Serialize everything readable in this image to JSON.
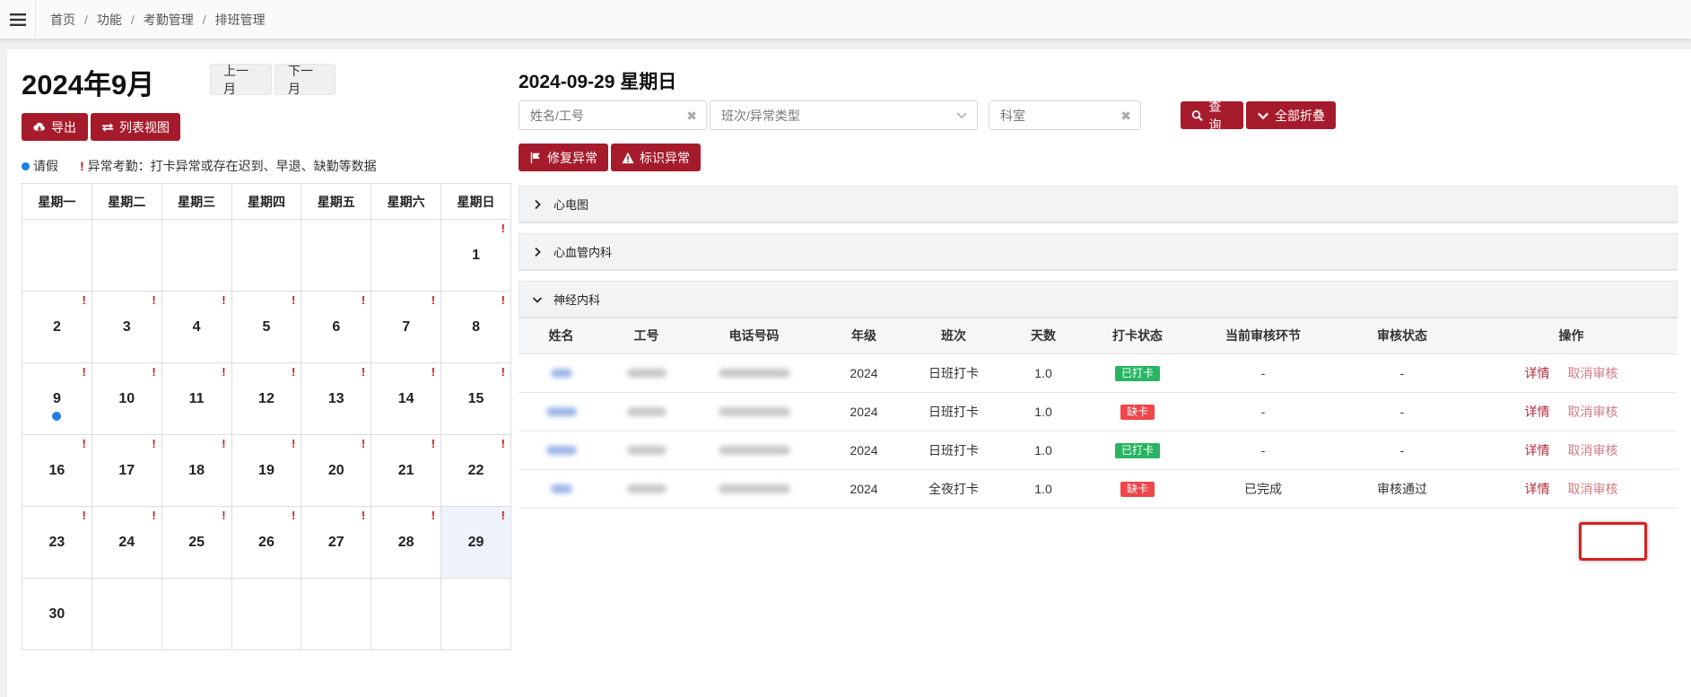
{
  "breadcrumb": [
    "首页",
    "功能",
    "考勤管理",
    "排班管理"
  ],
  "calendar": {
    "month_title": "2024年9月",
    "prev_label": "上一月",
    "next_label": "下一月",
    "export_label": "导出",
    "list_view_label": "列表视图",
    "legend_leave": "请假",
    "legend_abnormal": "异常考勤：打卡异常或存在迟到、早退、缺勤等数据",
    "weekdays": [
      "星期一",
      "星期二",
      "星期三",
      "星期四",
      "星期五",
      "星期六",
      "星期日"
    ],
    "weeks": [
      [
        null,
        null,
        null,
        null,
        null,
        null,
        {
          "d": "1",
          "abnormal": true
        }
      ],
      [
        {
          "d": "2",
          "abnormal": true
        },
        {
          "d": "3",
          "abnormal": true
        },
        {
          "d": "4",
          "abnormal": true
        },
        {
          "d": "5",
          "abnormal": true
        },
        {
          "d": "6",
          "abnormal": true
        },
        {
          "d": "7",
          "abnormal": true
        },
        {
          "d": "8",
          "abnormal": true
        }
      ],
      [
        {
          "d": "9",
          "abnormal": true,
          "leave": true
        },
        {
          "d": "10",
          "abnormal": true
        },
        {
          "d": "11",
          "abnormal": true
        },
        {
          "d": "12",
          "abnormal": true
        },
        {
          "d": "13",
          "abnormal": true
        },
        {
          "d": "14",
          "abnormal": true
        },
        {
          "d": "15",
          "abnormal": true
        }
      ],
      [
        {
          "d": "16",
          "abnormal": true
        },
        {
          "d": "17",
          "abnormal": true
        },
        {
          "d": "18",
          "abnormal": true
        },
        {
          "d": "19",
          "abnormal": true
        },
        {
          "d": "20",
          "abnormal": true
        },
        {
          "d": "21",
          "abnormal": true
        },
        {
          "d": "22",
          "abnormal": true
        }
      ],
      [
        {
          "d": "23",
          "abnormal": true
        },
        {
          "d": "24",
          "abnormal": true
        },
        {
          "d": "25",
          "abnormal": true
        },
        {
          "d": "26",
          "abnormal": true
        },
        {
          "d": "27",
          "abnormal": true
        },
        {
          "d": "28",
          "abnormal": true
        },
        {
          "d": "29",
          "abnormal": true,
          "today": true
        }
      ],
      [
        {
          "d": "30"
        },
        null,
        null,
        null,
        null,
        null,
        null
      ]
    ]
  },
  "detail": {
    "date_title": "2024-09-29 星期日",
    "name_placeholder": "姓名/工号",
    "shift_placeholder": "班次/异常类型",
    "dept_placeholder": "科室",
    "query_label": "查询",
    "collapse_label": "全部折叠",
    "fix_label": "修复异常",
    "mark_label": "标识异常",
    "sections": [
      "心电图",
      "心血管内科",
      "神经内科"
    ],
    "columns": [
      "姓名",
      "工号",
      "电话号码",
      "年级",
      "班次",
      "天数",
      "打卡状态",
      "当前审核环节",
      "审核状态",
      "操作"
    ],
    "rows": [
      {
        "grade": "2024",
        "shift": "日班打卡",
        "days": "1.0",
        "status": "已打卡",
        "status_type": "ok",
        "stage": "-",
        "review": "-"
      },
      {
        "grade": "2024",
        "shift": "日班打卡",
        "days": "1.0",
        "status": "缺卡",
        "status_type": "miss",
        "stage": "-",
        "review": "-"
      },
      {
        "grade": "2024",
        "shift": "日班打卡",
        "days": "1.0",
        "status": "已打卡",
        "status_type": "ok",
        "stage": "-",
        "review": "-"
      },
      {
        "grade": "2024",
        "shift": "全夜打卡",
        "days": "1.0",
        "status": "缺卡",
        "status_type": "miss",
        "stage": "已完成",
        "review": "审核通过"
      }
    ],
    "op_detail": "详情",
    "op_cancel": "取消审核"
  },
  "colors": {
    "primary": "#a61b2b",
    "leave_dot": "#1d7fe0",
    "abnormal": "#d01818",
    "ok": "#28b563",
    "miss": "#f0454a"
  }
}
